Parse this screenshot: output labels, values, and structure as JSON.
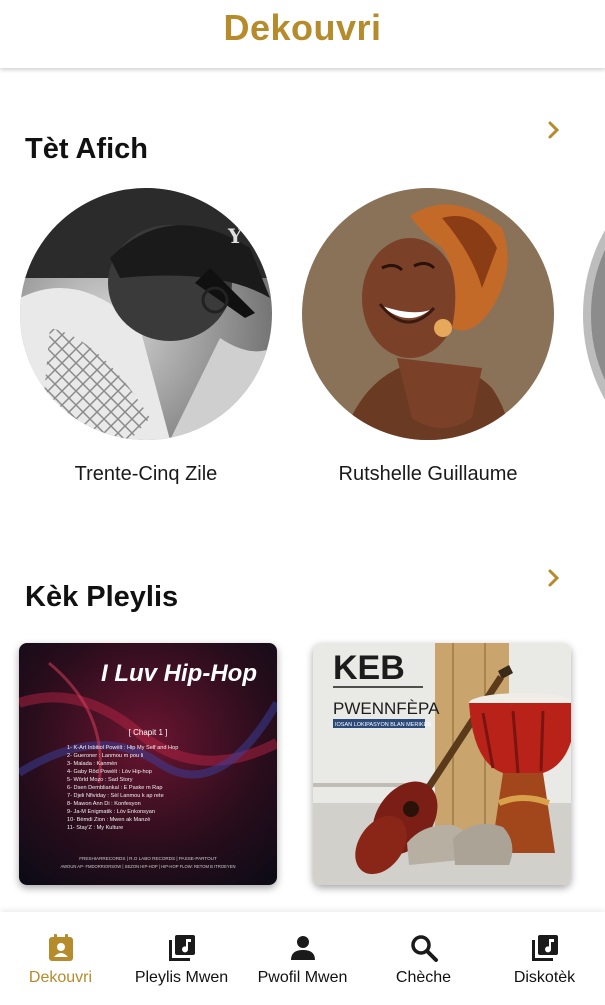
{
  "header": {
    "title": "Dekouvri"
  },
  "colors": {
    "accent": "#b58b2b",
    "text": "#111111"
  },
  "featured": {
    "title": "Tèt Afich",
    "more_icon": "chevron-right-icon",
    "artists": [
      {
        "name": "Trente-Cinq Zile"
      },
      {
        "name": "Rutshelle Guillaume"
      }
    ]
  },
  "playlists": {
    "title": "Kèk Pleylis",
    "more_icon": "chevron-right-icon",
    "items": [
      {
        "cover_title": "I Luv Hip-Hop",
        "cover_chapter": "[ Chapit 1 ]",
        "tracks": [
          "1- K-Art Inbitiol Powèlt : Hip My Self and Hop",
          "2- Gueroner : Lanmou m pou li",
          "3- Malada : Kanmèn",
          "4- Gaby Rōd Powèlt : Lòv Hip-hop",
          "5- Wōrld Mozo : Sad Story",
          "6- Dsen Dembliankal : E Paske m Rap",
          "7- Djeli Nfividay : Sèl Lanmou k ap rete",
          "8- Mawon Ann Di : Konfesyon",
          "9- Ja-M Enigmatik : Lòv Enkonsyan",
          "10- Bèmdi Zion : Mwen ak Manzè",
          "11- Stay'Z : My Kulture"
        ],
        "footer_line1": "FRESHIARRECORDS | R.O LABO RECORDS | PASSE-PARTOUT",
        "footer_line2": "AWOUN AP- FMDORRIORSOW | SEZON HIP-HOP | HIP-HOP FLOW: RETOM B ITROEYEN"
      },
      {
        "cover_title": "KEB",
        "cover_subtitle": "PWENNFÈPA",
        "cover_tagline": "IOSAN LOKIPASYON BLAN MERIKEN"
      }
    ]
  },
  "nav": {
    "items": [
      {
        "label": "Dekouvri",
        "icon": "discover-icon",
        "active": true
      },
      {
        "label": "Pleylis Mwen",
        "icon": "playlist-icon",
        "active": false
      },
      {
        "label": "Pwofil Mwen",
        "icon": "person-icon",
        "active": false
      },
      {
        "label": "Chèche",
        "icon": "search-icon",
        "active": false
      },
      {
        "label": "Diskotèk",
        "icon": "library-icon",
        "active": false
      }
    ]
  }
}
